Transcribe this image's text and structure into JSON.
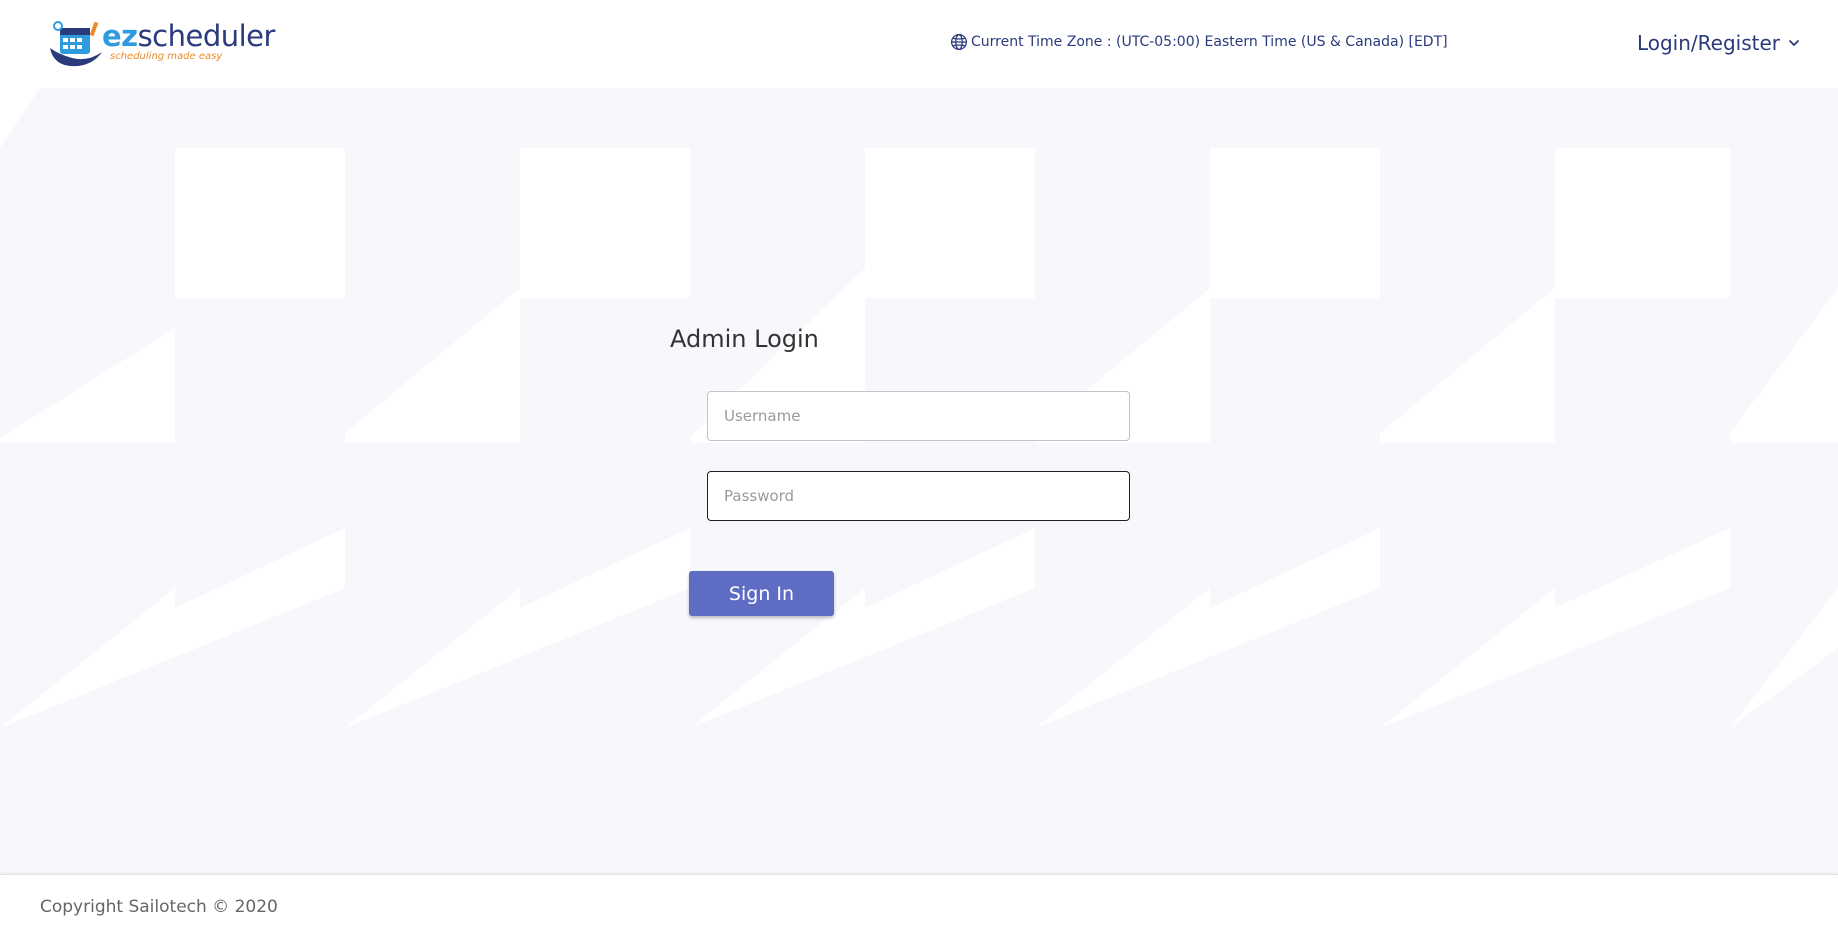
{
  "header": {
    "logo": {
      "name_prefix": "ez",
      "name_rest": "scheduler",
      "tagline": "scheduling made easy"
    },
    "timezone_text": "Current Time Zone : (UTC-05:00) Eastern Time (US & Canada) [EDT]",
    "timezone_icon": "globe-icon",
    "login_menu": {
      "label": "Login/Register",
      "icon": "chevron-down-icon"
    }
  },
  "login": {
    "title": "Admin Login",
    "username": {
      "value": "",
      "placeholder": "Username"
    },
    "password": {
      "value": "",
      "placeholder": "Password"
    },
    "submit_label": "Sign In"
  },
  "footer": {
    "copyright": "Copyright Sailotech © 2020"
  },
  "colors": {
    "brand_navy": "#2a3a7c",
    "brand_blue": "#2e9be0",
    "brand_orange": "#e98b2a",
    "button": "#5f6cc4"
  }
}
